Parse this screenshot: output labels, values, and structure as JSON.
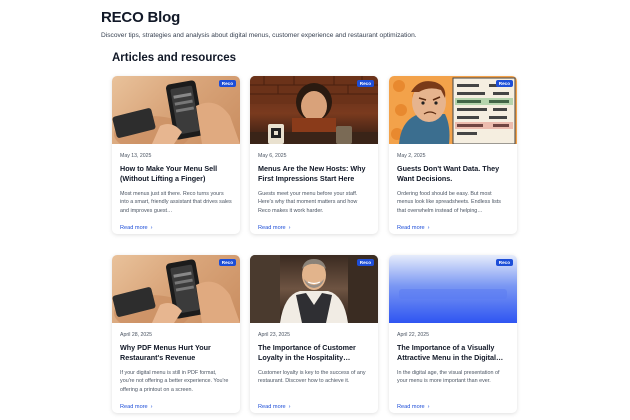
{
  "header": {
    "title": "RECO Blog",
    "subtitle": "Discover tips, strategies and analysis about digital menus, customer experience and restaurant optimization."
  },
  "section": {
    "title": "Articles and resources"
  },
  "badge_label": "Reco",
  "read_more": "Read more",
  "articles": [
    {
      "date": "May 13, 2025",
      "title": "How to Make Your Menu Sell (Without Lifting a Finger)",
      "excerpt": "Most menus just sit there. Reco turns yours into a smart, friendly assistant that drives sales and improves guest…",
      "image": "hand-phone-menu"
    },
    {
      "date": "May 6, 2025",
      "title": "Menus Are the New Hosts: Why First Impressions Start Here",
      "excerpt": "Guests meet your menu before your staff. Here's why that moment matters and how Reco makes it work harder.",
      "image": "illustrated-diner-qr"
    },
    {
      "date": "May 2, 2025",
      "title": "Guests Don't Want Data. They Want Decisions.",
      "excerpt": "Ordering food should be easy. But most menus look like spreadsheets. Endless lists that overwhelm instead of helping…",
      "image": "confused-man-menu"
    },
    {
      "date": "April 28, 2025",
      "title": "Why PDF Menus Hurt Your Restaurant's Revenue",
      "excerpt": "If your digital menu is still in PDF format, you're not offering a better experience. You're offering a printout on a screen.",
      "image": "hand-phone-menu"
    },
    {
      "date": "April 23, 2025",
      "title": "The Importance of Customer Loyalty in the Hospitality…",
      "excerpt": "Customer loyalty is key to the success of any restaurant. Discover how to achieve it.",
      "image": "smiling-chef"
    },
    {
      "date": "April 22, 2025",
      "title": "The Importance of a Visually Attractive Menu in the Digital…",
      "excerpt": "In the digital age, the visual presentation of your menu is more important than ever.",
      "image": "blue-gradient"
    }
  ],
  "colors": {
    "accent": "#1d4ed8",
    "text": "#111827",
    "muted": "#4b5563"
  }
}
